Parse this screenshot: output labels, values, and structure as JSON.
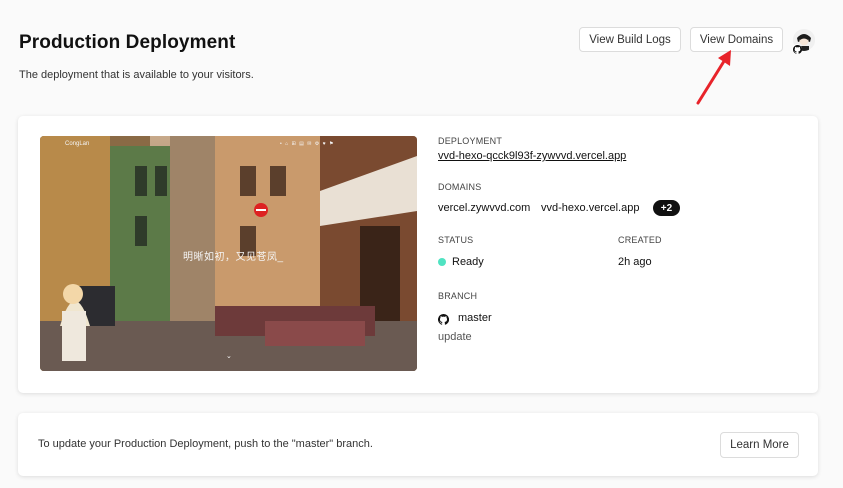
{
  "header": {
    "title": "Production Deployment",
    "subtitle": "The deployment that is available to your visitors.",
    "view_build_logs": "View Build Logs",
    "view_domains": "View Domains"
  },
  "preview": {
    "brand": "CongLan",
    "nav": "• ⌂ ⊞ ▤ ✉ ⚙ ♥ ⚑",
    "overlay_text": "明晰如初，又见苍凤_",
    "scroll_indicator": "⌄"
  },
  "deployment": {
    "label": "DEPLOYMENT",
    "url": "vvd-hexo-qcck9l93f-zywvvd.vercel.app"
  },
  "domains": {
    "label": "DOMAINS",
    "items": [
      "vercel.zywvvd.com",
      "vvd-hexo.vercel.app"
    ],
    "more_count": "+2"
  },
  "status": {
    "label": "STATUS",
    "value": "Ready",
    "color": "#50e3c2"
  },
  "created": {
    "label": "CREATED",
    "value": "2h ago"
  },
  "branch": {
    "label": "BRANCH",
    "name": "master",
    "commit_message": "update",
    "icon": "github-icon"
  },
  "footer": {
    "message": "To update your Production Deployment, push to the \"master\" branch.",
    "learn_more": "Learn More"
  },
  "annotation": {
    "arrow_color": "#e8232a"
  }
}
